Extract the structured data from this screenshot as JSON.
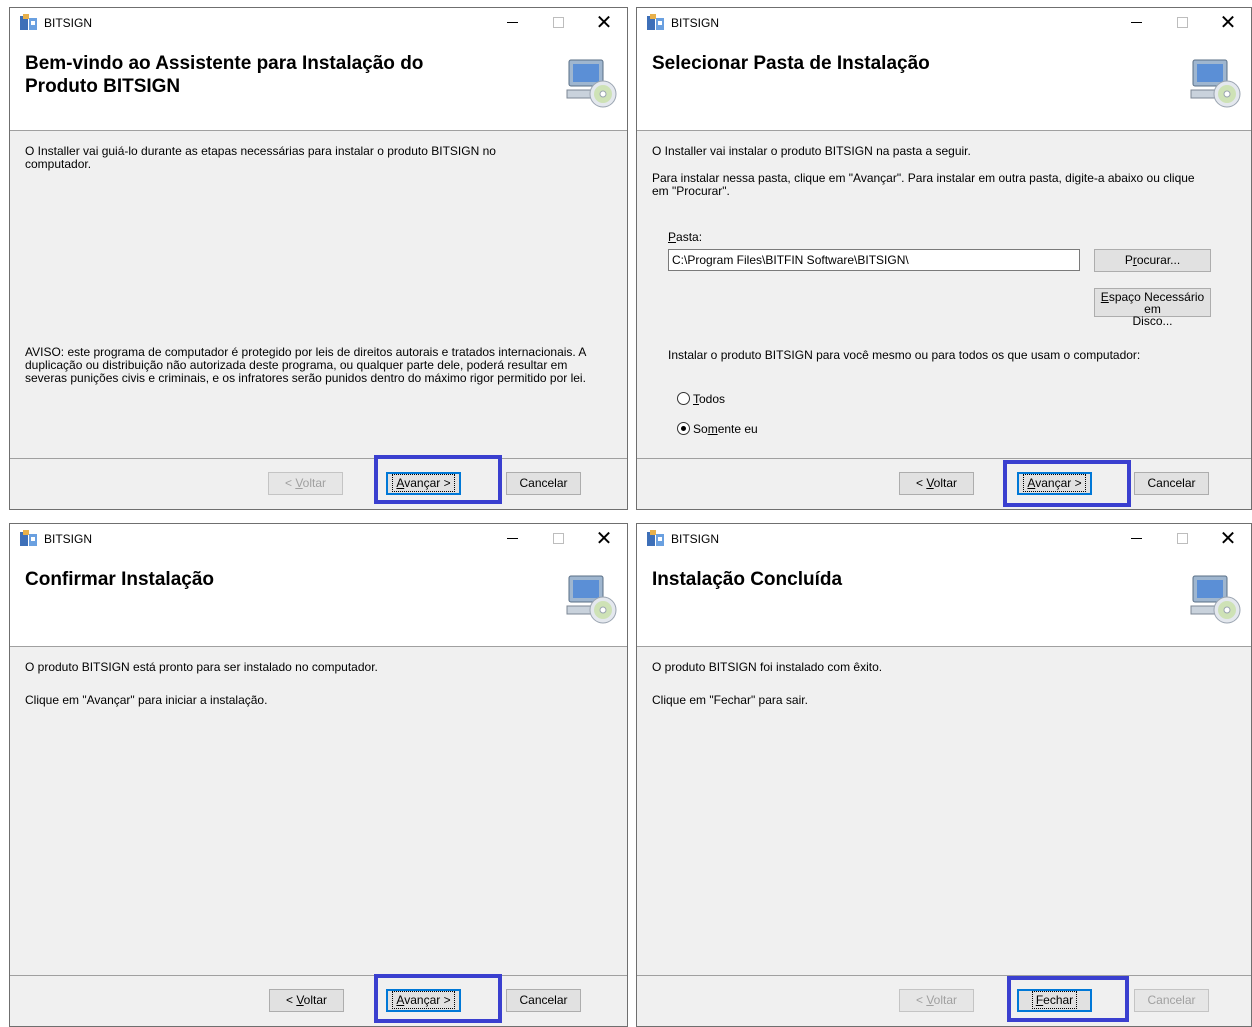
{
  "app_title": "BITSIGN",
  "colors": {
    "highlight": "#3a3fcf",
    "banner_bg": "#ffffff",
    "dialog_bg": "#f0f0f0"
  },
  "icons": [
    "installer-app-icon",
    "computer-cd-icon",
    "minimize-icon",
    "maximize-icon",
    "close-icon"
  ],
  "dialog1": {
    "banner_title": "Bem-vindo ao Assistente para Instalação do Produto BITSIGN",
    "intro": "O Installer vai guiá-lo durante as etapas necessárias para instalar o produto BITSIGN no computador.",
    "warning": "AVISO: este programa de computador é protegido por leis de direitos autorais e tratados internacionais. A duplicação ou distribuição não autorizada deste programa, ou qualquer parte dele, poderá resultar em severas punições civis e criminais, e os infratores serão punidos dentro do máximo rigor permitido por lei.",
    "back_label": "< Voltar",
    "next_label": "Avançar >",
    "cancel_label": "Cancelar"
  },
  "dialog2": {
    "banner_title": "Selecionar Pasta de Instalação",
    "intro": "O Installer vai instalar o produto BITSIGN na pasta a seguir.",
    "instructions": "Para instalar nessa pasta, clique em \"Avançar\". Para instalar em outra pasta, digite-a abaixo ou clique em \"Procurar\".",
    "folder_label": "Pasta:",
    "folder_value": "C:\\Program Files\\BITFIN Software\\BITSIGN\\",
    "browse_label": "Procurar...",
    "disk_cost_line1": "Espaço Necessário em",
    "disk_cost_line2": "Disco...",
    "scope_question": "Instalar o produto BITSIGN para você mesmo ou para todos os que usam o computador:",
    "radio_all": "Todos",
    "radio_me": "Somente eu",
    "selected_scope": "Somente eu",
    "back_label": "< Voltar",
    "next_label": "Avançar >",
    "cancel_label": "Cancelar"
  },
  "dialog3": {
    "banner_title": "Confirmar Instalação",
    "line1": "O produto BITSIGN está pronto para ser instalado no computador.",
    "line2": "Clique em \"Avançar\" para iniciar a instalação.",
    "back_label": "< Voltar",
    "next_label": "Avançar >",
    "cancel_label": "Cancelar"
  },
  "dialog4": {
    "banner_title": "Instalação Concluída",
    "line1": "O produto BITSIGN foi instalado com êxito.",
    "line2": "Clique em \"Fechar\" para sair.",
    "back_label": "< Voltar",
    "close_label": "Fechar",
    "cancel_label": "Cancelar"
  }
}
